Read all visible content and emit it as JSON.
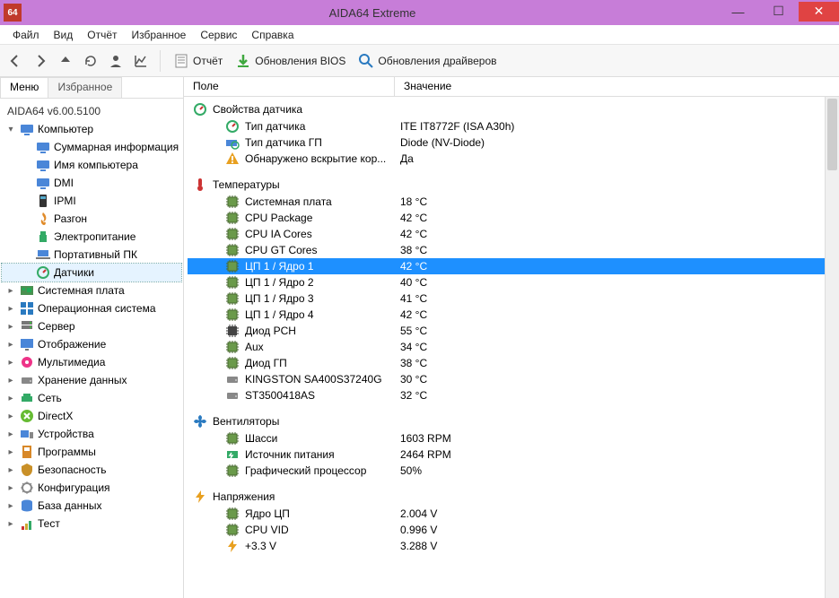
{
  "window": {
    "title": "AIDA64 Extreme"
  },
  "winbtns": {
    "min": "—",
    "max": "☐",
    "close": "✕"
  },
  "menubar": [
    "Файл",
    "Вид",
    "Отчёт",
    "Избранное",
    "Сервис",
    "Справка"
  ],
  "toolbar": {
    "report": "Отчёт",
    "bios": "Обновления BIOS",
    "drivers": "Обновления драйверов"
  },
  "tabs": {
    "menu": "Меню",
    "fav": "Избранное"
  },
  "version": "AIDA64 v6.00.5100",
  "tree": [
    {
      "label": "Компьютер",
      "icon": "monitor",
      "children": [
        {
          "label": "Суммарная информация",
          "icon": "monitor"
        },
        {
          "label": "Имя компьютера",
          "icon": "monitor"
        },
        {
          "label": "DMI",
          "icon": "monitor"
        },
        {
          "label": "IPMI",
          "icon": "ipmi"
        },
        {
          "label": "Разгон",
          "icon": "fire"
        },
        {
          "label": "Электропитание",
          "icon": "power"
        },
        {
          "label": "Портативный ПК",
          "icon": "laptop"
        },
        {
          "label": "Датчики",
          "icon": "sensor",
          "selected": true
        }
      ],
      "expanded": true
    },
    {
      "label": "Системная плата",
      "icon": "mb"
    },
    {
      "label": "Операционная система",
      "icon": "os"
    },
    {
      "label": "Сервер",
      "icon": "server"
    },
    {
      "label": "Отображение",
      "icon": "display"
    },
    {
      "label": "Мультимедиа",
      "icon": "media"
    },
    {
      "label": "Хранение данных",
      "icon": "hdd"
    },
    {
      "label": "Сеть",
      "icon": "net"
    },
    {
      "label": "DirectX",
      "icon": "dx"
    },
    {
      "label": "Устройства",
      "icon": "devices"
    },
    {
      "label": "Программы",
      "icon": "programs"
    },
    {
      "label": "Безопасность",
      "icon": "security"
    },
    {
      "label": "Конфигурация",
      "icon": "config"
    },
    {
      "label": "База данных",
      "icon": "db"
    },
    {
      "label": "Тест",
      "icon": "test"
    }
  ],
  "columns": {
    "field": "Поле",
    "value": "Значение"
  },
  "sections": [
    {
      "title": "Свойства датчика",
      "icon": "sensor",
      "rows": [
        {
          "icon": "sensor",
          "label": "Тип датчика",
          "value": "ITE IT8772F  (ISA A30h)"
        },
        {
          "icon": "gpu-sensor",
          "label": "Тип датчика ГП",
          "value": "Diode  (NV-Diode)"
        },
        {
          "icon": "warn",
          "label": "Обнаружено вскрытие кор...",
          "value": "Да"
        }
      ]
    },
    {
      "title": "Температуры",
      "icon": "thermo",
      "rows": [
        {
          "icon": "chip",
          "label": "Системная плата",
          "value": "18 °C"
        },
        {
          "icon": "chip",
          "label": "CPU Package",
          "value": "42 °C"
        },
        {
          "icon": "chip",
          "label": "CPU IA Cores",
          "value": "42 °C"
        },
        {
          "icon": "chip",
          "label": "CPU GT Cores",
          "value": "38 °C"
        },
        {
          "icon": "chip",
          "label": "ЦП 1 / Ядро 1",
          "value": "42 °C",
          "selected": true
        },
        {
          "icon": "chip",
          "label": "ЦП 1 / Ядро 2",
          "value": "40 °C"
        },
        {
          "icon": "chip",
          "label": "ЦП 1 / Ядро 3",
          "value": "41 °C"
        },
        {
          "icon": "chip",
          "label": "ЦП 1 / Ядро 4",
          "value": "42 °C"
        },
        {
          "icon": "chip2",
          "label": "Диод PCH",
          "value": "55 °C"
        },
        {
          "icon": "chip",
          "label": "Aux",
          "value": "34 °C"
        },
        {
          "icon": "chip",
          "label": "Диод ГП",
          "value": "38 °C"
        },
        {
          "icon": "hdd",
          "label": "KINGSTON SA400S37240G",
          "value": "30 °C"
        },
        {
          "icon": "hdd",
          "label": "ST3500418AS",
          "value": "32 °C"
        }
      ]
    },
    {
      "title": "Вентиляторы",
      "icon": "fan",
      "rows": [
        {
          "icon": "chip",
          "label": "Шасси",
          "value": "1603 RPM"
        },
        {
          "icon": "psu",
          "label": "Источник питания",
          "value": "2464 RPM"
        },
        {
          "icon": "chip",
          "label": "Графический процессор",
          "value": "50%"
        }
      ]
    },
    {
      "title": "Напряжения",
      "icon": "bolt",
      "rows": [
        {
          "icon": "chip",
          "label": "Ядро ЦП",
          "value": "2.004 V"
        },
        {
          "icon": "chip",
          "label": "CPU VID",
          "value": "0.996 V"
        },
        {
          "icon": "bolt",
          "label": "+3.3 V",
          "value": "3.288 V"
        }
      ]
    }
  ]
}
